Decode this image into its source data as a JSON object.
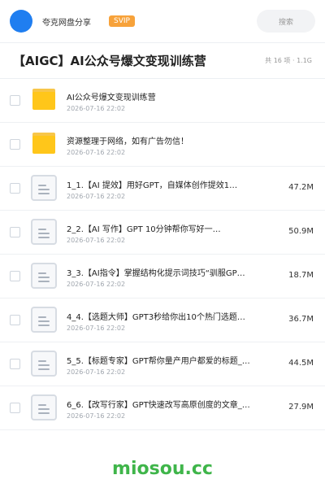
{
  "header": {
    "brand": "夸克网盘分享",
    "badge": "SVIP",
    "search_placeholder": "搜索"
  },
  "folder": {
    "title": "【AIGC】AI公众号爆文变现训练营",
    "meta": "共 16 项 · 1.1G"
  },
  "items": [
    {
      "type": "folder",
      "name": "AI公众号爆文变现训练营",
      "date": "2026-07-16 22:02",
      "size": ""
    },
    {
      "type": "folder",
      "name": "资源整理于网络，如有广告勿信！",
      "date": "2026-07-16 22:02",
      "size": ""
    },
    {
      "type": "file",
      "name": "1_1.【AI 提效】用好GPT，自媒体创作提效1…",
      "date": "2026-07-16 22:02",
      "size": "47.2M"
    },
    {
      "type": "file",
      "name": "2_2.【AI 写作】GPT 10分钟帮你写好一…",
      "date": "2026-07-16 22:02",
      "size": "50.9M"
    },
    {
      "type": "file",
      "name": "3_3.【AI指令】掌握结构化提示词技巧“驯服GP…",
      "date": "2026-07-16 22:02",
      "size": "18.7M"
    },
    {
      "type": "file",
      "name": "4_4.【选题大师】GPT3秒给你出10个热门选题…",
      "date": "2026-07-16 22:02",
      "size": "36.7M"
    },
    {
      "type": "file",
      "name": "5_5.【标题专家】GPT帮你量产用户都爱的标题_…",
      "date": "2026-07-16 22:02",
      "size": "44.5M"
    },
    {
      "type": "file",
      "name": "6_6.【改写行家】GPT快速改写高原创度的文章_…",
      "date": "2026-07-16 22:02",
      "size": "27.9M"
    }
  ],
  "watermark": "miosou.cc",
  "colors": {
    "accent": "#1f7ef0",
    "svip": "#f7a23a",
    "folder": "#ffc61a",
    "watermark": "#3fb54a"
  }
}
